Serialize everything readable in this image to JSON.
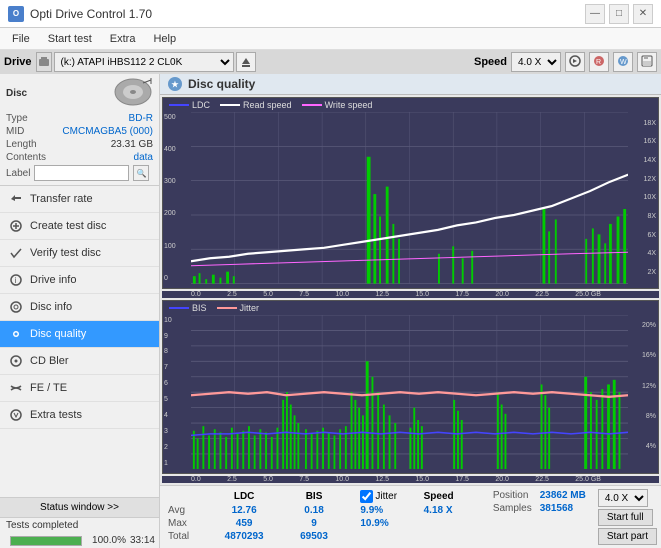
{
  "app": {
    "title": "Opti Drive Control 1.70",
    "icon_label": "O"
  },
  "title_buttons": {
    "minimize": "—",
    "maximize": "□",
    "close": "✕"
  },
  "menu": {
    "items": [
      "File",
      "Start test",
      "Extra",
      "Help"
    ]
  },
  "header": {
    "drive_label": "Drive",
    "drive_value": "(k:) ATAPI iHBS112  2 CL0K",
    "speed_label": "Speed",
    "speed_value": "4.0 X"
  },
  "disc": {
    "section_title": "Disc",
    "type_label": "Type",
    "type_value": "BD-R",
    "mid_label": "MID",
    "mid_value": "CMCMAGBA5 (000)",
    "length_label": "Length",
    "length_value": "23.31 GB",
    "contents_label": "Contents",
    "contents_value": "data",
    "label_label": "Label",
    "label_value": ""
  },
  "nav": {
    "items": [
      {
        "id": "transfer-rate",
        "label": "Transfer rate",
        "icon": "→"
      },
      {
        "id": "create-test-disc",
        "label": "Create test disc",
        "icon": "+"
      },
      {
        "id": "verify-test-disc",
        "label": "Verify test disc",
        "icon": "✓"
      },
      {
        "id": "drive-info",
        "label": "Drive info",
        "icon": "ℹ"
      },
      {
        "id": "disc-info",
        "label": "Disc info",
        "icon": "💿"
      },
      {
        "id": "disc-quality",
        "label": "Disc quality",
        "icon": "★",
        "active": true
      },
      {
        "id": "cd-bler",
        "label": "CD Bler",
        "icon": "◉"
      },
      {
        "id": "fe-te",
        "label": "FE / TE",
        "icon": "~"
      },
      {
        "id": "extra-tests",
        "label": "Extra tests",
        "icon": "⚙"
      }
    ]
  },
  "status_button": "Status window >>",
  "status": {
    "text": "Tests completed",
    "progress": 100,
    "time": "33:14"
  },
  "disc_quality": {
    "title": "Disc quality",
    "icon": "★",
    "legend": {
      "ldc": "LDC",
      "read_speed": "Read speed",
      "write_speed": "Write speed"
    },
    "legend2": {
      "bis": "BIS",
      "jitter": "Jitter"
    },
    "chart1_y_left": [
      "500",
      "400",
      "300",
      "200",
      "100",
      "0"
    ],
    "chart1_y_right": [
      "18X",
      "16X",
      "14X",
      "12X",
      "10X",
      "8X",
      "6X",
      "4X",
      "2X"
    ],
    "chart2_y_left": [
      "10",
      "9",
      "8",
      "7",
      "6",
      "5",
      "4",
      "3",
      "2",
      "1"
    ],
    "chart2_y_right": [
      "20%",
      "16%",
      "12%",
      "8%",
      "4%"
    ],
    "x_labels": [
      "0.0",
      "2.5",
      "5.0",
      "7.5",
      "10.0",
      "12.5",
      "15.0",
      "17.5",
      "20.0",
      "22.5",
      "25.0 GB"
    ]
  },
  "stats": {
    "headers": [
      "",
      "LDC",
      "BIS",
      "",
      "Jitter",
      "Speed",
      ""
    ],
    "avg_label": "Avg",
    "avg_ldc": "12.76",
    "avg_bis": "0.18",
    "avg_jitter": "9.9%",
    "avg_speed": "4.18 X",
    "max_label": "Max",
    "max_ldc": "459",
    "max_bis": "9",
    "max_jitter": "10.9%",
    "total_label": "Total",
    "total_ldc": "4870293",
    "total_bis": "69503",
    "position_label": "Position",
    "position_value": "23862 MB",
    "samples_label": "Samples",
    "samples_value": "381568",
    "speed_dropdown_value": "4.0 X",
    "start_full_label": "Start full",
    "start_part_label": "Start part",
    "jitter_checked": true,
    "jitter_label": "Jitter"
  }
}
